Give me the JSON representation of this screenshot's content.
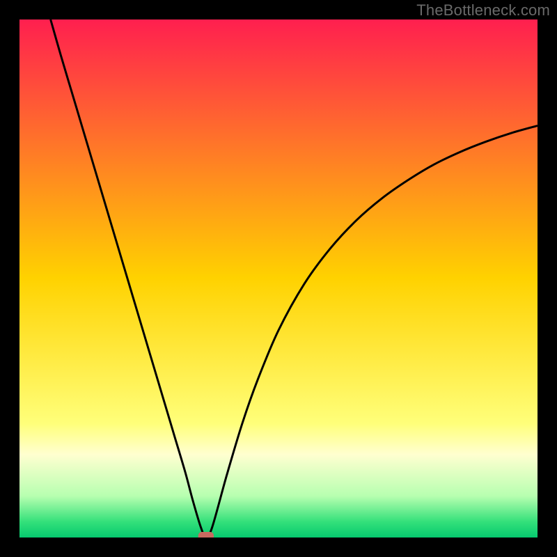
{
  "watermark": "TheBottleneck.com",
  "chart_data": {
    "type": "line",
    "title": "",
    "xlabel": "",
    "ylabel": "",
    "xlim": [
      0,
      100
    ],
    "ylim": [
      0,
      100
    ],
    "grid": false,
    "background_gradient": {
      "stops": [
        {
          "offset": 0.0,
          "color": "#ff1f4f"
        },
        {
          "offset": 0.5,
          "color": "#ffd200"
        },
        {
          "offset": 0.78,
          "color": "#ffff7a"
        },
        {
          "offset": 0.84,
          "color": "#ffffd0"
        },
        {
          "offset": 0.92,
          "color": "#b7ffb0"
        },
        {
          "offset": 0.97,
          "color": "#33e07a"
        },
        {
          "offset": 1.0,
          "color": "#06c96f"
        }
      ]
    },
    "series": [
      {
        "name": "bottleneck-curve",
        "x": [
          6,
          8,
          10,
          12,
          14,
          16,
          18,
          20,
          22,
          24,
          26,
          28,
          30,
          32,
          33.5,
          35,
          36,
          37.2,
          40,
          43,
          46,
          50,
          55,
          60,
          65,
          70,
          75,
          80,
          85,
          90,
          95,
          100
        ],
        "y": [
          100,
          93,
          86.3,
          79.6,
          72.9,
          66.2,
          59.5,
          52.8,
          46.1,
          39.4,
          32.7,
          26.0,
          19.3,
          12.6,
          7.0,
          2.0,
          0.0,
          2.0,
          12.0,
          22.0,
          30.5,
          40.0,
          49.0,
          55.8,
          61.2,
          65.5,
          69.0,
          72.0,
          74.4,
          76.4,
          78.1,
          79.5
        ],
        "color": "#000000",
        "line_width": 3
      }
    ],
    "annotations": [
      {
        "name": "bottleneck-marker",
        "shape": "rounded-rect",
        "x": 36,
        "y": 0,
        "width_pct": 3.0,
        "height_pct": 1.6,
        "color": "#c86a60"
      }
    ]
  }
}
